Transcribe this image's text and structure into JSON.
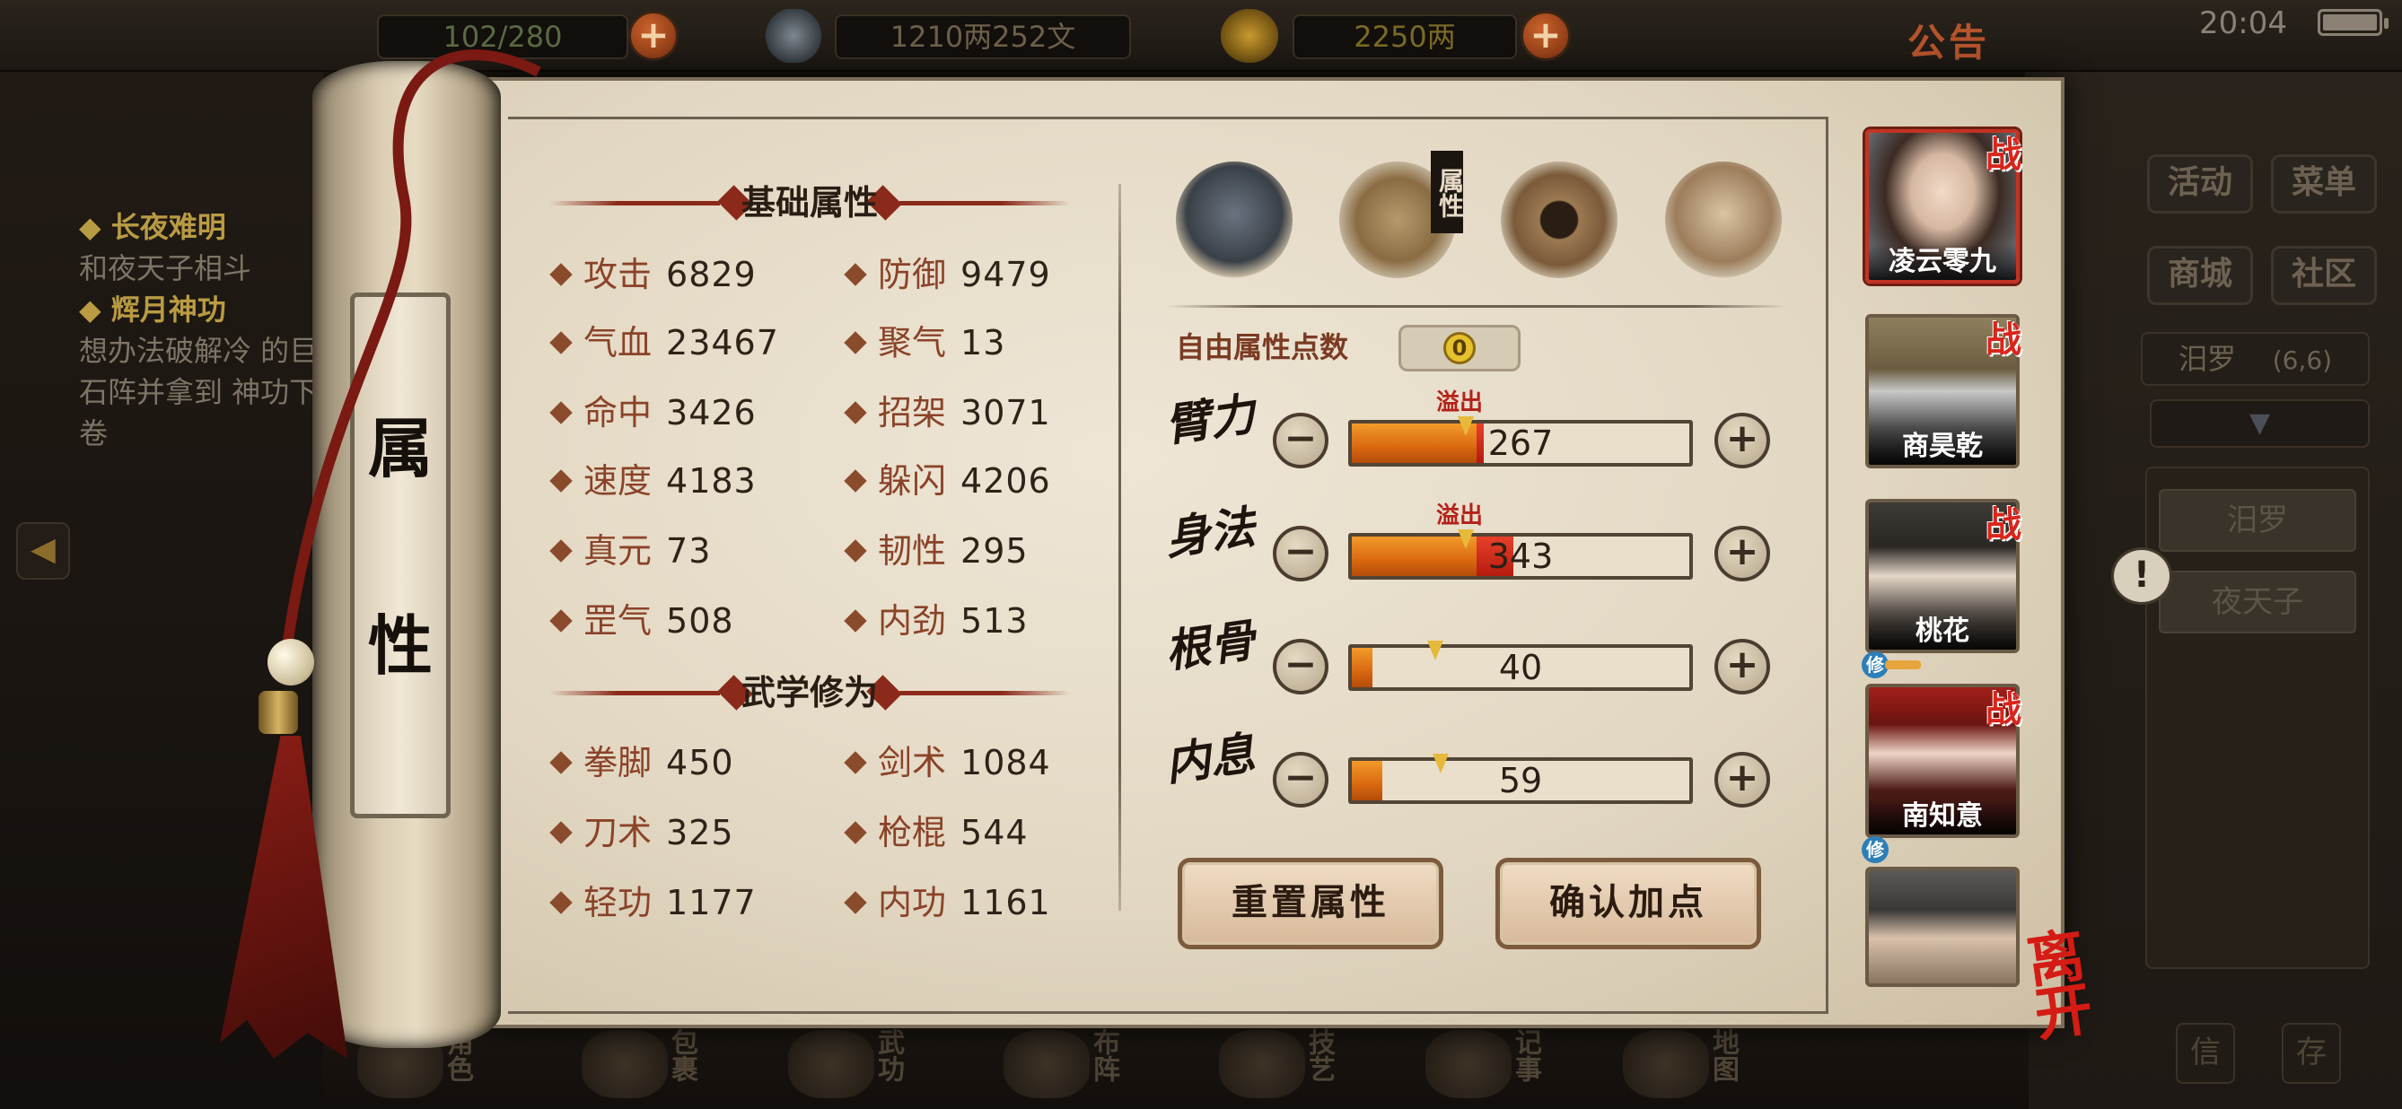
{
  "topbar": {
    "stamina": "102/280",
    "money_copper": "1210两252文",
    "gold": "2250两",
    "notice_label": "公告",
    "time": "20:04"
  },
  "quest": {
    "items": [
      {
        "title": "长夜难明",
        "desc": "和夜天子相斗"
      },
      {
        "title": "辉月神功",
        "desc": "想办法破解冷 的巨石阵并拿到 神功下卷"
      }
    ]
  },
  "scroll_title": [
    "属",
    "性"
  ],
  "basic": {
    "heading": "基础属性",
    "stats": [
      {
        "label": "攻击",
        "value": "6829"
      },
      {
        "label": "防御",
        "value": "9479"
      },
      {
        "label": "气血",
        "value": "23467"
      },
      {
        "label": "聚气",
        "value": "13"
      },
      {
        "label": "命中",
        "value": "3426"
      },
      {
        "label": "招架",
        "value": "3071"
      },
      {
        "label": "速度",
        "value": "4183"
      },
      {
        "label": "躲闪",
        "value": "4206"
      },
      {
        "label": "真元",
        "value": "73"
      },
      {
        "label": "韧性",
        "value": "295"
      },
      {
        "label": "罡气",
        "value": "508"
      },
      {
        "label": "内劲",
        "value": "513"
      }
    ]
  },
  "martial": {
    "heading": "武学修为",
    "stats": [
      {
        "label": "拳脚",
        "value": "450"
      },
      {
        "label": "剑术",
        "value": "1084"
      },
      {
        "label": "刀术",
        "value": "325"
      },
      {
        "label": "枪棍",
        "value": "544"
      },
      {
        "label": "轻功",
        "value": "1177"
      },
      {
        "label": "内功",
        "value": "1161"
      }
    ]
  },
  "tabs": {
    "active_label": "属性",
    "icons": [
      "hero-icon",
      "book-icon",
      "bagua-icon",
      "muscle-icon"
    ]
  },
  "allocation": {
    "free_points_label": "自由属性点数",
    "free_points_value": "0",
    "overflow_label": "溢出",
    "attributes": [
      {
        "name": "臂力",
        "value": "267",
        "fill_fraction": 0.37,
        "overflow_fraction": 0.02,
        "overflow": true
      },
      {
        "name": "身法",
        "value": "343",
        "fill_fraction": 0.37,
        "overflow_fraction": 0.11,
        "overflow": true
      },
      {
        "name": "根骨",
        "value": "40",
        "fill_fraction": 0.06,
        "overflow_fraction": 0,
        "overflow": false
      },
      {
        "name": "内息",
        "value": "59",
        "fill_fraction": 0.09,
        "overflow_fraction": 0,
        "overflow": false
      }
    ],
    "minus_symbol": "−",
    "plus_symbol": "+",
    "reset_label": "重置属性",
    "confirm_label": "确认加点"
  },
  "party": {
    "battle_mark": "战",
    "cultivate_mark": "修",
    "members": [
      {
        "name": "凌云零九",
        "battle": true,
        "cultivate": false,
        "active": true
      },
      {
        "name": "商昊乾",
        "battle": true,
        "cultivate": false,
        "active": false
      },
      {
        "name": "桃花",
        "battle": true,
        "cultivate": true,
        "active": false
      },
      {
        "name": "南知意",
        "battle": true,
        "cultivate": true,
        "active": false
      },
      {
        "name": "",
        "battle": false,
        "cultivate": false,
        "active": false
      }
    ],
    "leave_label": "离开"
  },
  "right_panel": {
    "buttons": [
      "活动",
      "菜单",
      "商城",
      "社区"
    ],
    "location": "汨罗",
    "coords": "(6,6)",
    "list": [
      "汨罗",
      "夜天子"
    ],
    "hint_mark": "!"
  },
  "bottom_nav": [
    "角色",
    "包裹",
    "武功",
    "布阵",
    "技艺",
    "记事",
    "地图"
  ],
  "bottom_small": [
    "信",
    "存"
  ],
  "colors": {
    "accent_red": "#b3221a",
    "bar_orange": "#d96810",
    "paper": "#e2d7c2"
  }
}
